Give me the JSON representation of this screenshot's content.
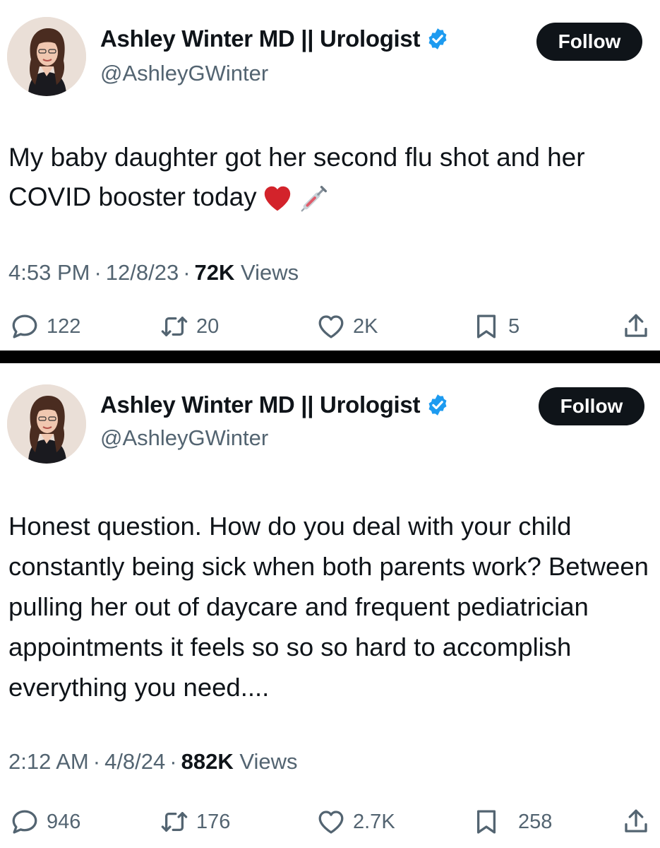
{
  "tweets": [
    {
      "author_name": "Ashley Winter MD || Urologist",
      "handle": "@AshleyGWinter",
      "follow_label": "Follow",
      "text": "My baby daughter got her second flu shot and her COVID booster today",
      "emojis": [
        "red-heart",
        "syringe"
      ],
      "time": "4:53 PM",
      "date": "12/8/23",
      "views_count": "72K",
      "views_label": "Views",
      "replies": "122",
      "reposts": "20",
      "likes": "2K",
      "bookmarks": "5"
    },
    {
      "author_name": "Ashley Winter MD || Urologist",
      "handle": "@AshleyGWinter",
      "follow_label": "Follow",
      "text": "Honest question. How do you deal with your child constantly being sick when both parents work? Between pulling her out of daycare and frequent pediatrician appointments it feels so so so hard to accomplish everything you need....",
      "time": "2:12 AM",
      "date": "4/8/24",
      "views_count": "882K",
      "views_label": "Views",
      "replies": "946",
      "reposts": "176",
      "likes": "2.7K",
      "bookmarks": "258"
    }
  ],
  "colors": {
    "text": "#0f1419",
    "secondary": "#536471",
    "verified": "#1d9bf0",
    "button_bg": "#0f1419",
    "divider": "#000000"
  },
  "icons": [
    "reply-icon",
    "repost-icon",
    "like-icon",
    "bookmark-icon",
    "share-icon",
    "verified-badge-icon"
  ]
}
